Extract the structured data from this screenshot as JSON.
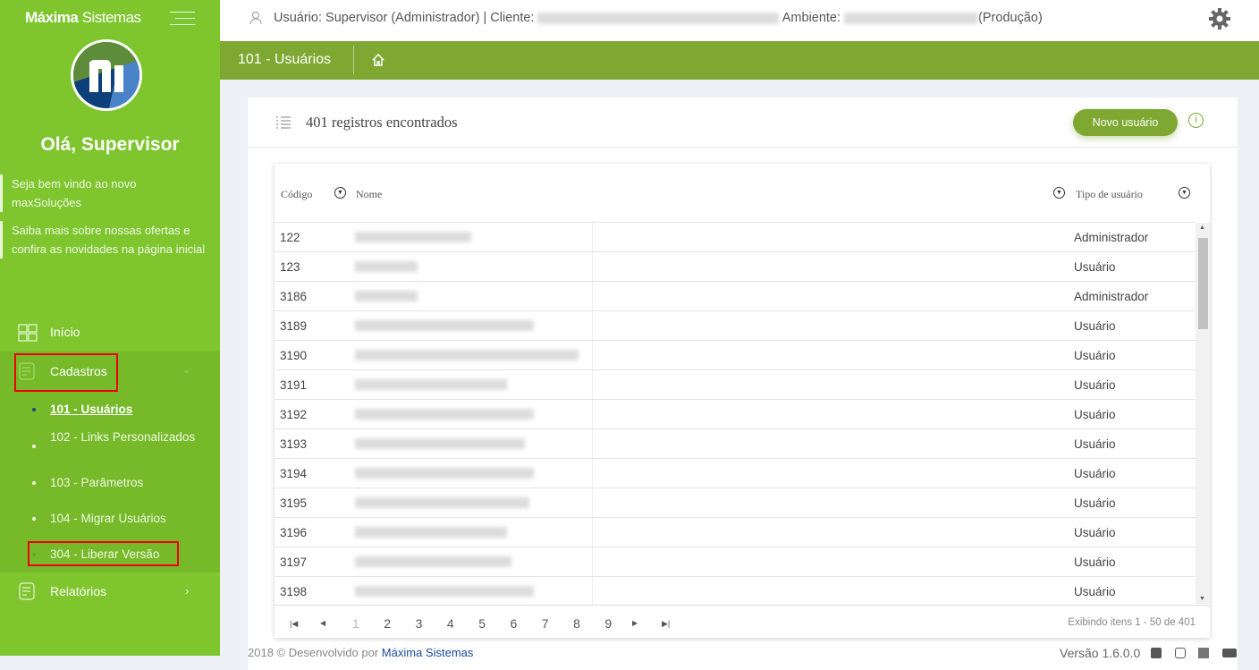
{
  "sidebar": {
    "brand_bold": "Máxima",
    "brand_light": "Sistemas",
    "greeting": "Olá, Supervisor",
    "messages": [
      "Seja bem vindo ao novo maxSoluções",
      "Saiba mais sobre nossas ofertas e confira as novidades na página inicial"
    ],
    "nav": [
      {
        "label": "Início",
        "icon": "grid-icon"
      },
      {
        "label": "Cadastros",
        "icon": "checklist-icon",
        "expanded": true
      },
      {
        "label": "Relatórios",
        "icon": "checklist-icon"
      }
    ],
    "subitems": [
      {
        "label": "101 - Usuários",
        "active": true
      },
      {
        "label": "102 - Links Personalizados"
      },
      {
        "label": "103 - Parâmetros"
      },
      {
        "label": "104 - Migrar Usuários"
      },
      {
        "label": "304 - Liberar Versão"
      }
    ]
  },
  "topbar": {
    "user": "Usuário: Supervisor (Administrador) | Cliente:",
    "ambiente": "Ambiente:",
    "env": "(Produção)"
  },
  "breadcrumb": {
    "title": "101 - Usuários"
  },
  "main": {
    "count_label": "401 registros encontrados",
    "new_button": "Novo usuário",
    "columns": [
      "Código",
      "Nome",
      "Tipo de usuário"
    ],
    "rows": [
      {
        "code": "122",
        "type": "Administrador"
      },
      {
        "code": "123",
        "type": "Usuário"
      },
      {
        "code": "3186",
        "type": "Administrador"
      },
      {
        "code": "3189",
        "type": "Usuário"
      },
      {
        "code": "3190",
        "type": "Usuário"
      },
      {
        "code": "3191",
        "type": "Usuário"
      },
      {
        "code": "3192",
        "type": "Usuário"
      },
      {
        "code": "3193",
        "type": "Usuário"
      },
      {
        "code": "3194",
        "type": "Usuário"
      },
      {
        "code": "3195",
        "type": "Usuário"
      },
      {
        "code": "3196",
        "type": "Usuário"
      },
      {
        "code": "3197",
        "type": "Usuário"
      },
      {
        "code": "3198",
        "type": "Usuário"
      }
    ],
    "pages": [
      "1",
      "2",
      "3",
      "4",
      "5",
      "6",
      "7",
      "8",
      "9"
    ],
    "current_page": "1",
    "showing": "Exibindo itens 1 - 50 de 401"
  },
  "footer": {
    "copyright": "2018 © Desenvolvido por",
    "company": "Máxima Sistemas",
    "version": "Versão 1.6.0.0"
  },
  "colors": {
    "sidebar": "#7ec52e",
    "accent": "#7ea832",
    "highlight": "#e00000"
  }
}
